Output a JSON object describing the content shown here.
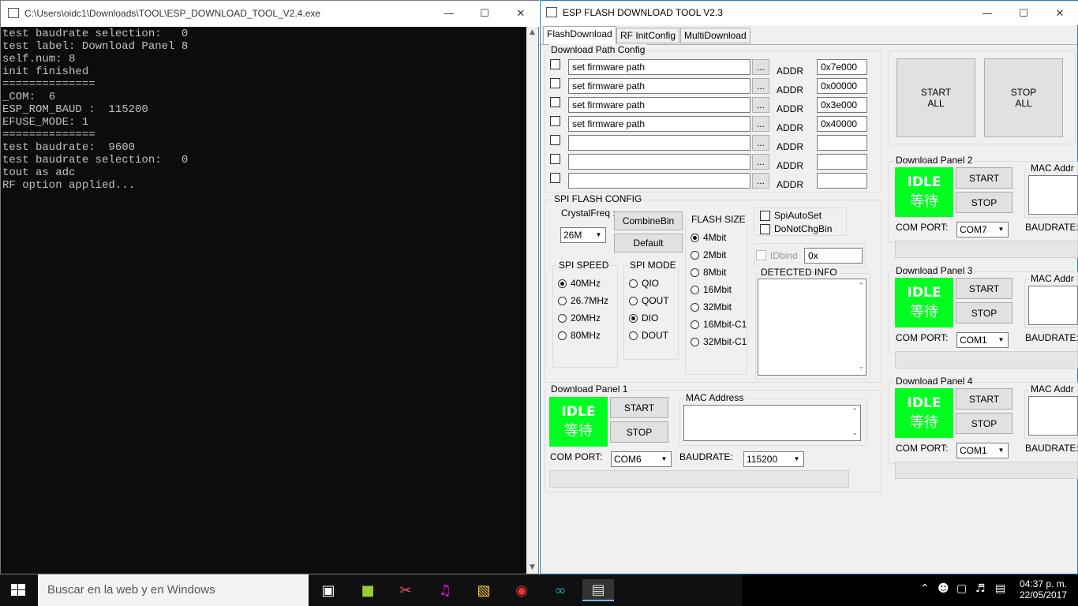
{
  "console": {
    "title": "C:\\Users\\oidc1\\Downloads\\TOOL\\ESP_DOWNLOAD_TOOL_V2.4.exe",
    "lines": [
      "test baudrate selection:   0",
      "test label: Download Panel 8",
      "self.num: 8",
      "init finished",
      "==============",
      "_COM:  6",
      "ESP_ROM_BAUD :  115200",
      "EFUSE_MODE: 1",
      "==============",
      "test baudrate:  9600",
      "test baudrate selection:   0",
      "tout as adc",
      "RF option applied..."
    ]
  },
  "esp": {
    "title": "ESP FLASH DOWNLOAD TOOL V2.3",
    "tabs": [
      "FlashDownload",
      "RF InitConfig",
      "MultiDownload"
    ],
    "path_config": {
      "label": "Download Path Config",
      "rows": [
        {
          "path": "set firmware path",
          "addr": "0x7e000"
        },
        {
          "path": "set firmware path",
          "addr": "0x00000"
        },
        {
          "path": "set firmware path",
          "addr": "0x3e000"
        },
        {
          "path": "set firmware path",
          "addr": "0x40000"
        },
        {
          "path": "",
          "addr": ""
        },
        {
          "path": "",
          "addr": ""
        },
        {
          "path": "",
          "addr": ""
        }
      ],
      "browse": "...",
      "addr_label": "ADDR"
    },
    "start_all": "START\nALL",
    "stop_all": "STOP\nALL",
    "spi": {
      "label": "SPI FLASH CONFIG",
      "crystal_label": "CrystalFreq :",
      "crystal_value": "26M",
      "combine": "CombineBin",
      "default": "Default",
      "speed_label": "SPI SPEED",
      "speeds": [
        "40MHz",
        "26.7MHz",
        "20MHz",
        "80MHz"
      ],
      "mode_label": "SPI MODE",
      "modes": [
        "QIO",
        "QOUT",
        "DIO",
        "DOUT"
      ],
      "size_label": "FLASH SIZE",
      "sizes": [
        "4Mbit",
        "2Mbit",
        "8Mbit",
        "16Mbit",
        "32Mbit",
        "16Mbit-C1",
        "32Mbit-C1"
      ],
      "spiautoset": "SpiAutoSet",
      "donotchg": "DoNotChgBin",
      "idbind": "IDbind",
      "idbind_value": "0x",
      "detected": "DETECTED INFO"
    },
    "panel1": {
      "label": "Download Panel 1",
      "idle": "IDLE",
      "idle_cn": "等待",
      "start": "START",
      "stop": "STOP",
      "mac": "MAC Address",
      "com_label": "COM PORT:",
      "com": "COM6",
      "baud_label": "BAUDRATE:",
      "baud": "115200"
    },
    "panels": [
      {
        "label": "Download Panel 2",
        "com": "COM7"
      },
      {
        "label": "Download Panel 3",
        "com": "COM1"
      },
      {
        "label": "Download Panel 4",
        "com": "COM1"
      }
    ],
    "panel_common": {
      "idle": "IDLE",
      "idle_cn": "等待",
      "start": "START",
      "stop": "STOP",
      "mac": "MAC Addr",
      "com_label": "COM PORT:",
      "baud_label": "BAUDRATE:"
    }
  },
  "taskbar": {
    "search": "Buscar en la web y en Windows",
    "time": "04:37 p. m.",
    "date": "22/05/2017"
  }
}
